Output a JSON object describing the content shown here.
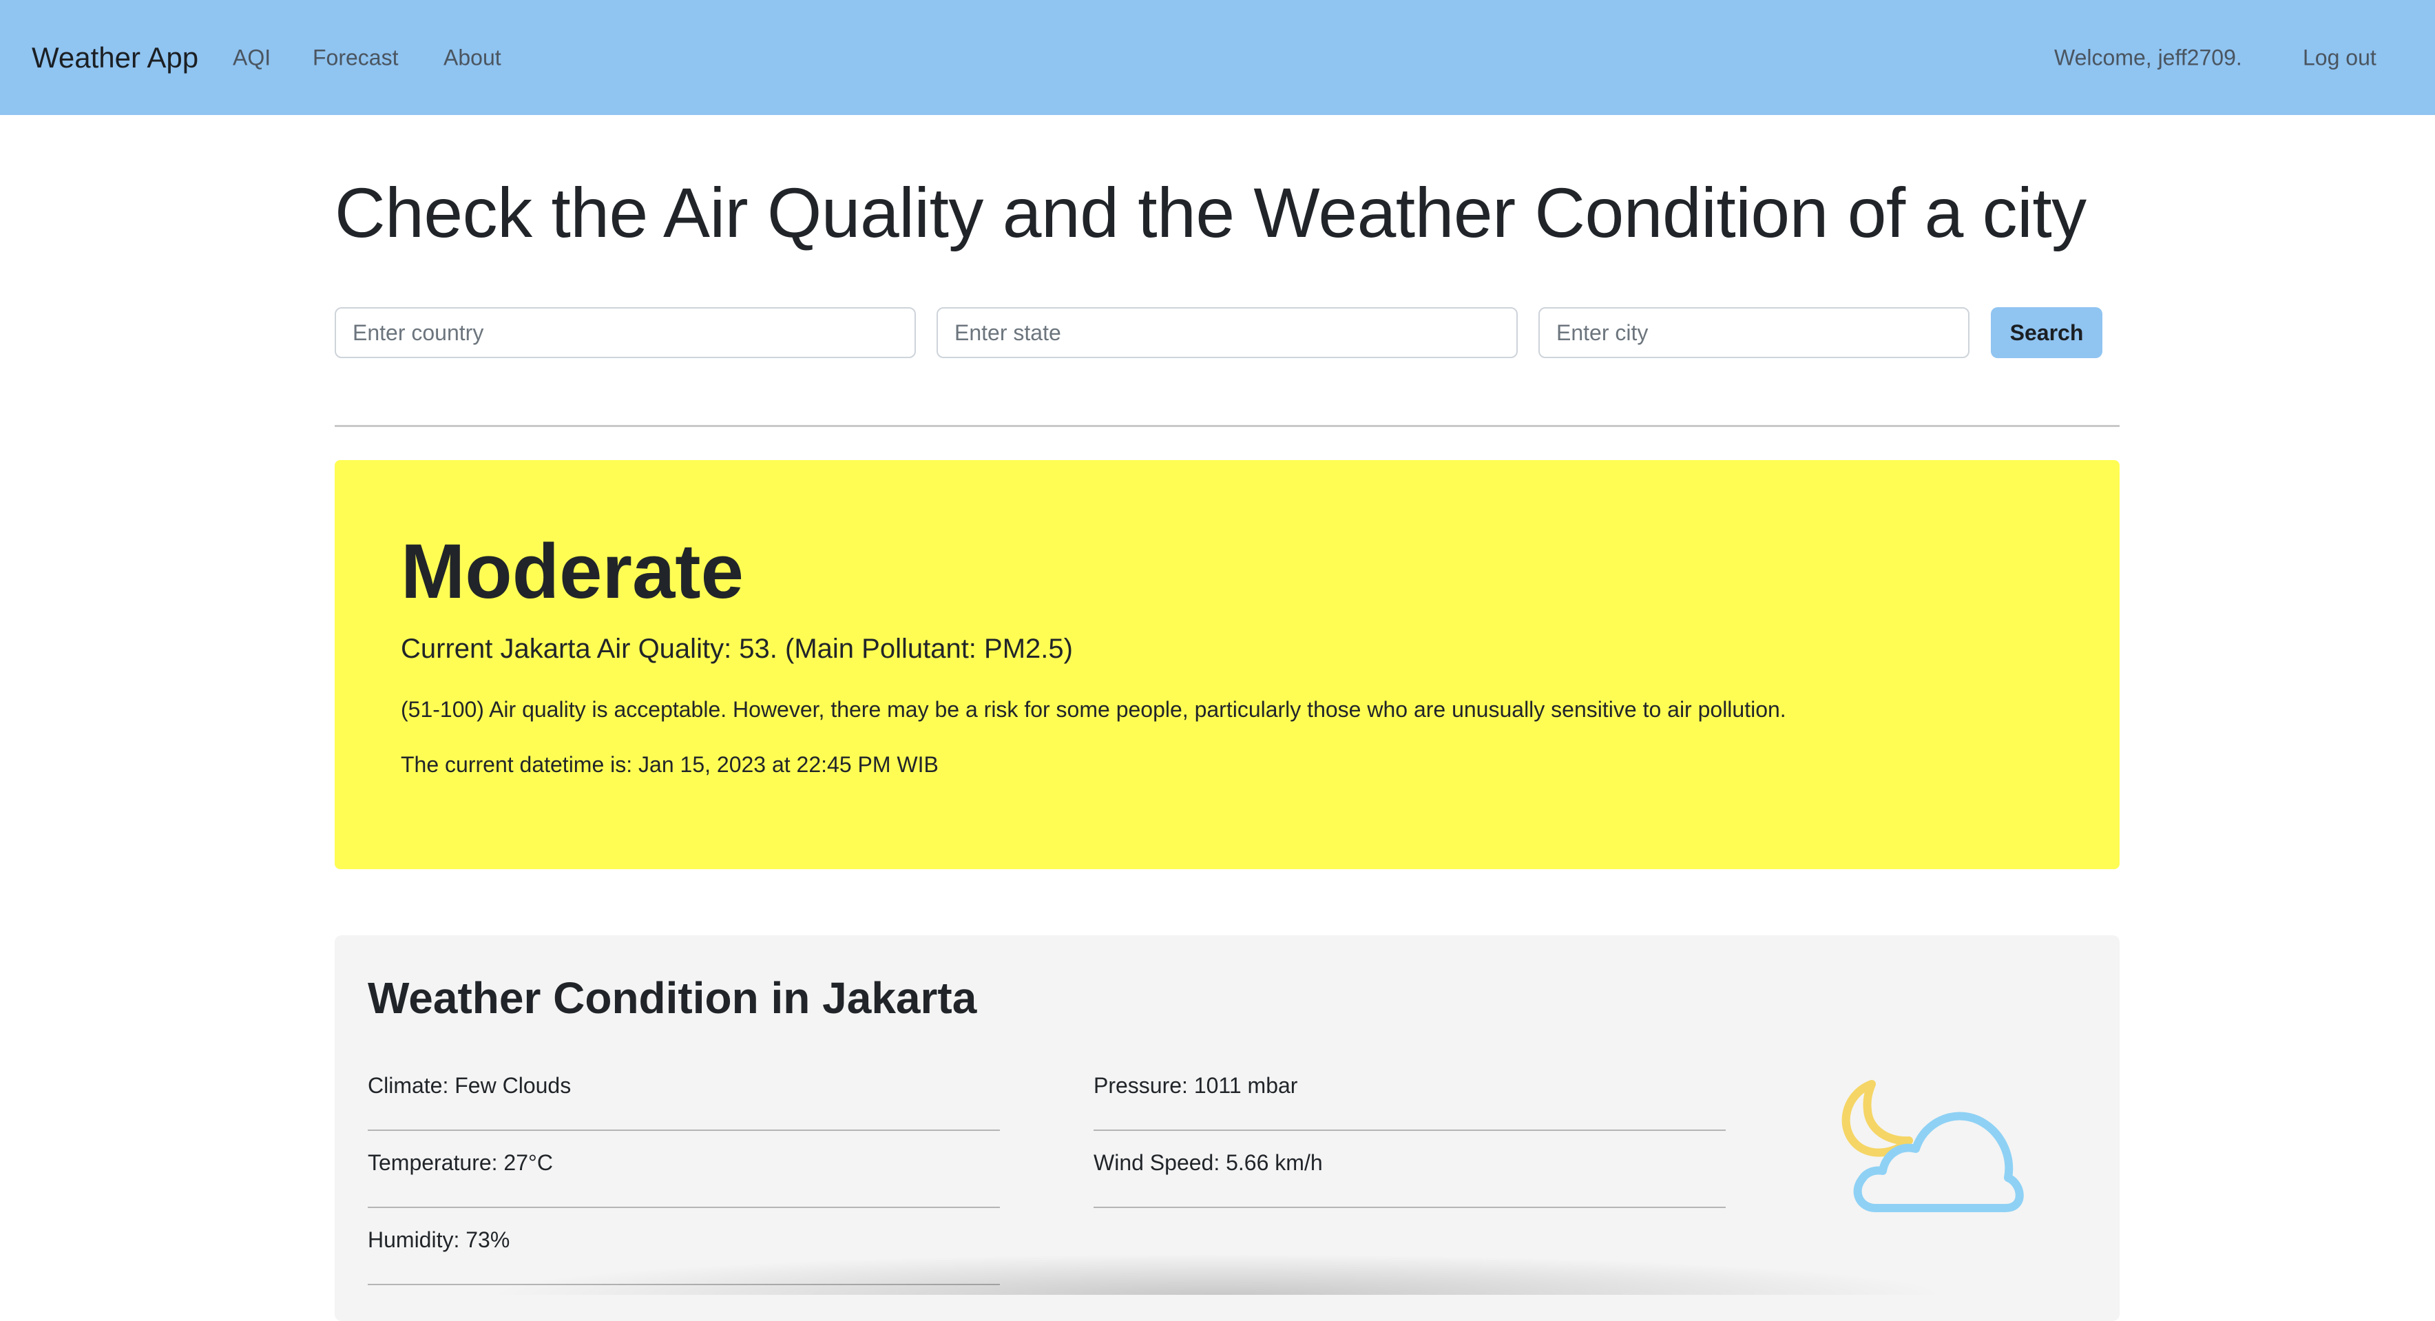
{
  "navbar": {
    "brand": "Weather App",
    "links": [
      "AQI",
      "Forecast",
      "About"
    ],
    "welcome": "Welcome, jeff2709.",
    "logout": "Log out",
    "background": "#90c4f1"
  },
  "page_title": "Check the Air Quality and the Weather Condition of a city",
  "search": {
    "country_placeholder": "Enter country",
    "state_placeholder": "Enter state",
    "city_placeholder": "Enter city",
    "country_value": "",
    "state_value": "",
    "city_value": "",
    "button_label": "Search"
  },
  "aqi": {
    "level": "Moderate",
    "current": "Current Jakarta Air Quality: 53. (Main Pollutant: PM2.5)",
    "description": "(51-100) Air quality is acceptable. However, there may be a risk for some people, particularly those who are unusually sensitive to air pollution.",
    "datetime": "The current datetime is: Jan 15, 2023 at 22:45 PM WIB",
    "card_color": "#fffd54"
  },
  "weather": {
    "title": "Weather Condition in Jakarta",
    "left": [
      "Climate: Few Clouds",
      "Temperature: 27°C",
      "Humidity: 73%"
    ],
    "right": [
      "Pressure: 1011 mbar",
      "Wind Speed: 5.66 km/h"
    ],
    "icon": "moon-cloud-icon",
    "moon_color": "#f5d565",
    "cloud_color": "#8ed1f5"
  }
}
